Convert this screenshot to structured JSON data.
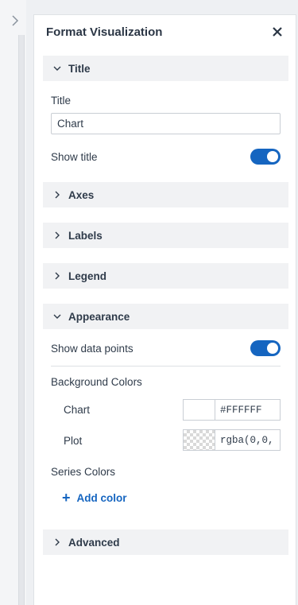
{
  "panel": {
    "title": "Format Visualization"
  },
  "sections": {
    "title": {
      "header": "Title",
      "expanded": true,
      "title_label": "Title",
      "title_value": "Chart",
      "show_title_label": "Show title",
      "show_title_on": true
    },
    "axes": {
      "header": "Axes",
      "expanded": false
    },
    "labels": {
      "header": "Labels",
      "expanded": false
    },
    "legend": {
      "header": "Legend",
      "expanded": false
    },
    "appearance": {
      "header": "Appearance",
      "expanded": true,
      "show_data_points_label": "Show data points",
      "show_data_points_on": true,
      "background_colors_label": "Background Colors",
      "chart_label": "Chart",
      "chart_color": "#FFFFFF",
      "plot_label": "Plot",
      "plot_color": "rgba(0,0,",
      "series_colors_label": "Series Colors",
      "add_color_label": "Add color"
    },
    "advanced": {
      "header": "Advanced",
      "expanded": false
    }
  },
  "colors": {
    "accent": "#1565c0",
    "section_bg": "#f1f2f4"
  }
}
